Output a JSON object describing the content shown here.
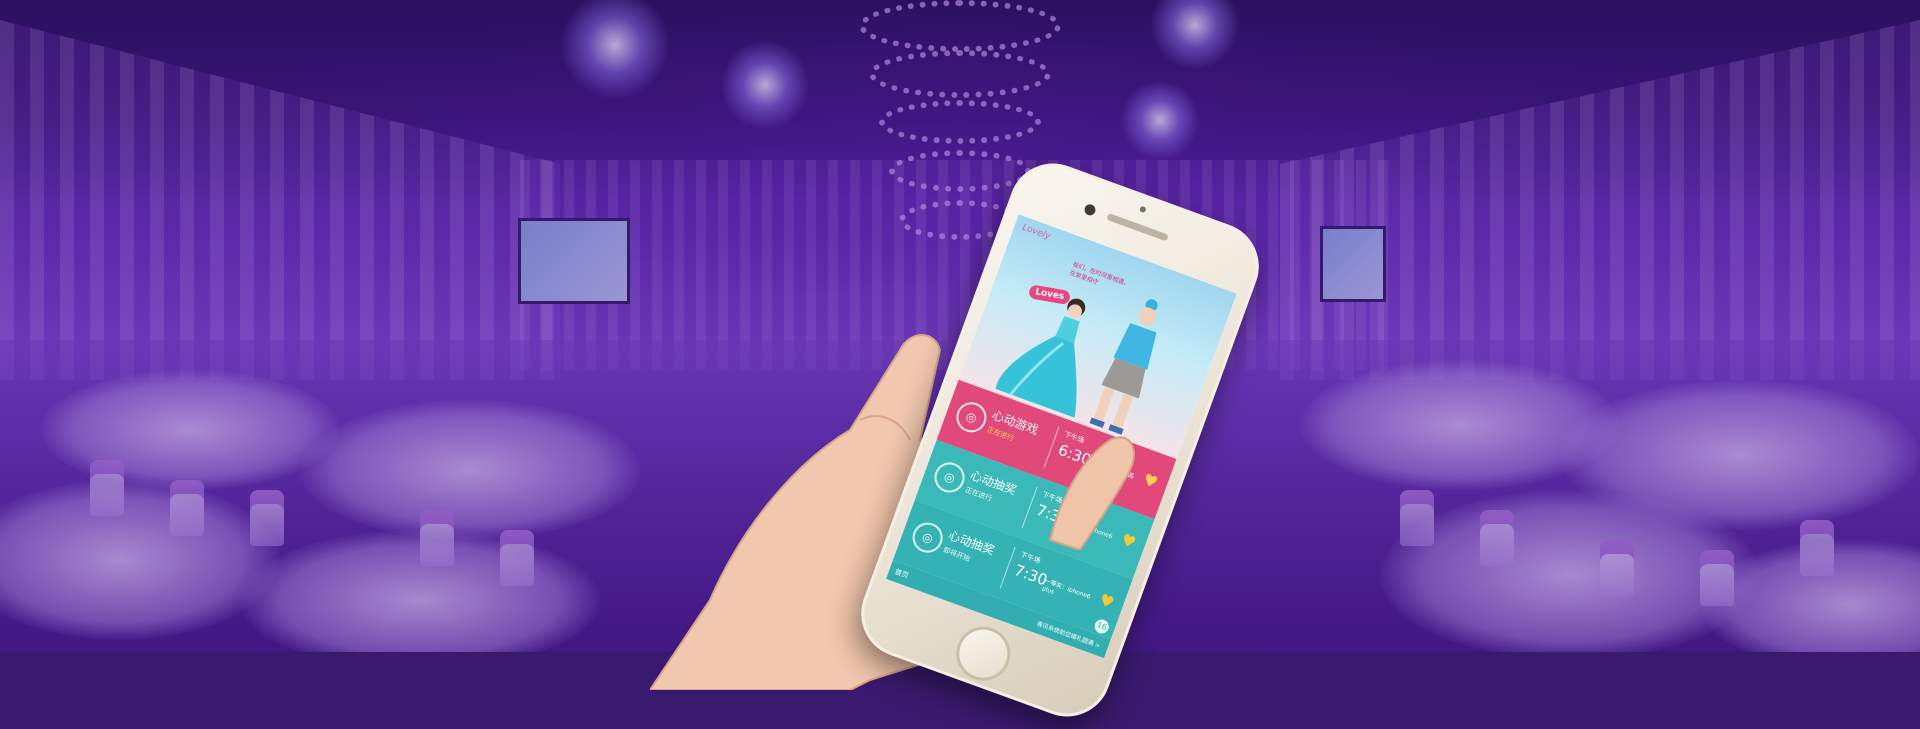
{
  "colors": {
    "background": "#5a27a8",
    "card_pink": "#e0497a",
    "card_teal": "#3bb8b8",
    "accent_gold": "#ffd24a"
  },
  "hero": {
    "logo": "Lovely",
    "quote": "我们，在时间里相遇，在爱里相守",
    "badge": "Loves"
  },
  "cards": [
    {
      "icon": "gamepad-icon",
      "title": "心动游戏",
      "sub": "正在进行",
      "session": "下午场",
      "time": "6:30",
      "note": "一等奖：精品礼品",
      "heart": "♥"
    },
    {
      "icon": "lottery-icon",
      "title": "心动抽奖",
      "sub": "正在进行",
      "session": "下午场",
      "time": "7:30",
      "note": "一等奖：iphone6 plus",
      "heart": "♥"
    },
    {
      "icon": "lottery-icon",
      "title": "心动抽奖",
      "sub": "即将开始",
      "session": "下午场",
      "time": "7:30",
      "note": "一等奖：iphone6 plus",
      "heart": "♥"
    }
  ],
  "footer": {
    "home": "首页",
    "link": "喜讯系统助您婚礼圆满 >",
    "more": "16"
  }
}
